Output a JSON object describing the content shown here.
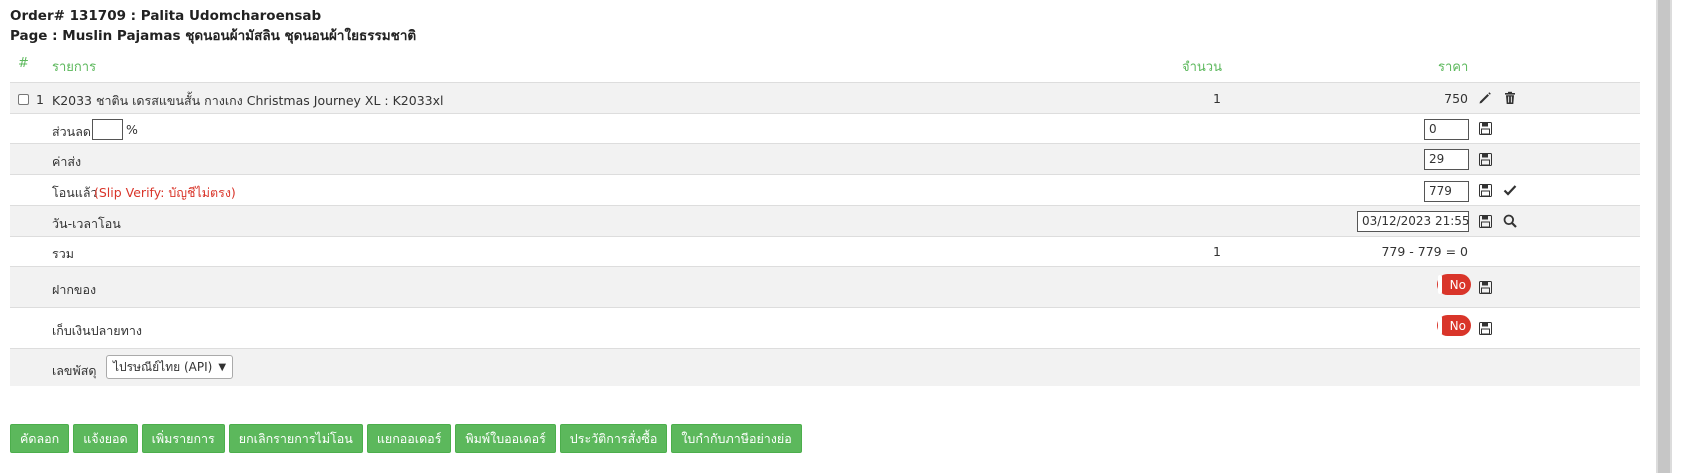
{
  "header": {
    "order_line": "Order# 131709 : Palita Udomcharoensab",
    "page_line": "Page : Muslin Pajamas ชุดนอนผ้ามัสลิน ชุดนอนผ้าใยธรรมชาติ"
  },
  "columns": {
    "hash": "#",
    "item": "รายการ",
    "qty": "จำนวน",
    "price": "ราคา"
  },
  "item": {
    "index": "1",
    "name": "K2033 ชาติน เดรสแขนสั้น กางเกง Christmas Journey XL : K2033xl",
    "qty": "1",
    "price": "750"
  },
  "discount": {
    "label": "ส่วนลด",
    "percent_value": "",
    "unit": "%",
    "value": "0"
  },
  "shipping": {
    "label": "ค่าส่ง",
    "value": "29"
  },
  "transfer": {
    "label": "โอนแล้ว",
    "status": "(Slip Verify: บัญชีไม่ตรง)",
    "value": "779"
  },
  "datetime": {
    "label": "วัน-เวลาโอน",
    "value": "03/12/2023 21:55"
  },
  "total": {
    "label": "รวม",
    "qty": "1",
    "summary": "779 - 779 = 0"
  },
  "deposit": {
    "label": "ฝากของ",
    "toggle": "No"
  },
  "cod": {
    "label": "เก็บเงินปลายทาง",
    "toggle": "No"
  },
  "tracking": {
    "label": "เลขพัสดุ",
    "carrier": "ไปรษณีย์ไทย (API)"
  },
  "buttons": {
    "copy": "คัดลอก",
    "notify": "แจ้งยอด",
    "add_item": "เพิ่มรายการ",
    "cancel_untransferred": "ยกเลิกรายการไม่โอน",
    "split_order": "แยกออเดอร์",
    "print_order": "พิมพ์ใบออเดอร์",
    "order_history": "ประวัติการสั่งซื้อ",
    "short_tax_invoice": "ใบกำกับภาษีอย่างย่อ"
  },
  "colors": {
    "accent": "#5cb85c",
    "warning": "#d9352a",
    "row_alt": "#f2f2f2"
  },
  "icons": [
    "pencil-icon",
    "trash-icon",
    "save-icon",
    "check-icon",
    "search-icon",
    "chevron-down-icon"
  ]
}
